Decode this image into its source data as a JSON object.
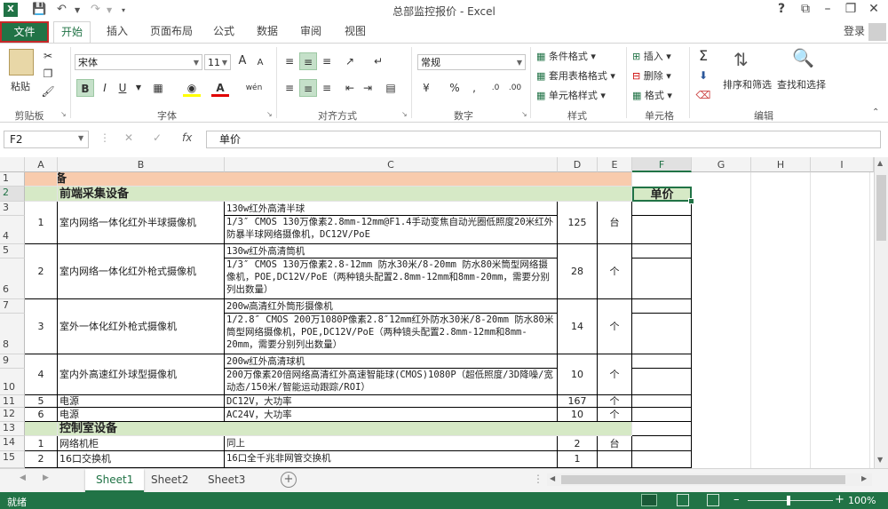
{
  "window": {
    "title": "总部监控报价 - Excel",
    "help": "?",
    "login": "登录"
  },
  "tabs": {
    "file": "文件",
    "items": [
      "开始",
      "插入",
      "页面布局",
      "公式",
      "数据",
      "审阅",
      "视图"
    ]
  },
  "ribbon": {
    "clipboard": {
      "label": "剪贴板",
      "paste": "粘贴"
    },
    "font": {
      "label": "字体",
      "name": "宋体",
      "size": "11",
      "bold": "B",
      "italic": "I",
      "underline": "U",
      "grow": "A",
      "shrink": "A",
      "color_letter": "A",
      "phonetic": "wén"
    },
    "alignment": {
      "label": "对齐方式"
    },
    "number": {
      "label": "数字",
      "format": "常规"
    },
    "styles": {
      "label": "样式",
      "conditional": "条件格式",
      "table": "套用表格格式",
      "cell_styles": "单元格样式"
    },
    "cells": {
      "label": "单元格",
      "insert": "插入",
      "delete": "删除",
      "format": "格式"
    },
    "editing": {
      "label": "编辑",
      "sort": "排序和筛选",
      "find": "查找和选择"
    }
  },
  "formula_bar": {
    "name_box": "F2",
    "fx": "fx",
    "content": "单价"
  },
  "columns": [
    "A",
    "B",
    "C",
    "D",
    "E",
    "F",
    "G",
    "H",
    "I"
  ],
  "rows": [
    "1",
    "2",
    "3",
    "4",
    "5",
    "6",
    "7",
    "8",
    "9",
    "10",
    "11",
    "12",
    "13",
    "14",
    "15"
  ],
  "cells": {
    "r1": {
      "b": "设备"
    },
    "r2": {
      "b": "前端采集设备",
      "f": "单价"
    },
    "item1": {
      "a": "1",
      "b": "室内网络一体化红外半球摄像机",
      "c1": "130w红外高清半球",
      "c2": "1/3″ CMOS 130万像素2.8mm-12mm@F1.4手动变焦自动光圈低照度20米红外防暴半球网络摄像机，DC12V/PoE",
      "d": "125",
      "e": "台"
    },
    "item2": {
      "a": "2",
      "b": "室内网络一体化红外枪式摄像机",
      "c1": "130w红外高清筒机",
      "c2": "1/3″ CMOS 130万像素2.8-12mm 防水30米/8-20mm 防水80米筒型网络摄像机，POE,DC12V/PoE（两种镜头配置2.8mm-12mm和8mm-20mm，需要分别列出数量）",
      "d": "28",
      "e": "个"
    },
    "item3": {
      "a": "3",
      "b": "室外一体化红外枪式摄像机",
      "c1": "200w高清红外筒形摄像机",
      "c2": "1/2.8″ CMOS 200万1080P像素2.8″12mm红外防水30米/8-20mm 防水80米筒型网络摄像机，POE,DC12V/PoE（两种镜头配置2.8mm-12mm和8mm-20mm，需要分别列出数量）",
      "d": "14",
      "e": "个"
    },
    "item4": {
      "a": "4",
      "b": "室内外高速红外球型摄像机",
      "c1": "200w红外高清球机",
      "c2": "200万像素20倍网络高清红外高速智能球(CMOS)1080P（超低照度/3D降噪/宽动态/150米/智能运动跟踪/ROI）",
      "d": "10",
      "e": "个"
    },
    "item5": {
      "a": "5",
      "b": "电源",
      "c": "DC12V，大功率",
      "d": "167",
      "e": "个"
    },
    "item6": {
      "a": "6",
      "b": "电源",
      "c": "AC24V，大功率",
      "d": "10",
      "e": "个"
    },
    "r13": {
      "b": "控制室设备"
    },
    "r14": {
      "a": "1",
      "b": "网络机柜",
      "c": "同上",
      "d": "2",
      "e": "台"
    },
    "r15": {
      "a": "2",
      "b": "16口交换机",
      "c": "16口全千兆非网管交换机",
      "d": "1",
      "e": ""
    }
  },
  "sheets": [
    "Sheet1",
    "Sheet2",
    "Sheet3"
  ],
  "status": {
    "ready": "就绪",
    "zoom": "100%",
    "zoom_level": 1.0
  },
  "colors": {
    "accent": "#217346",
    "section_orange": "#f8cbad",
    "section_green": "#d6e9c6"
  }
}
